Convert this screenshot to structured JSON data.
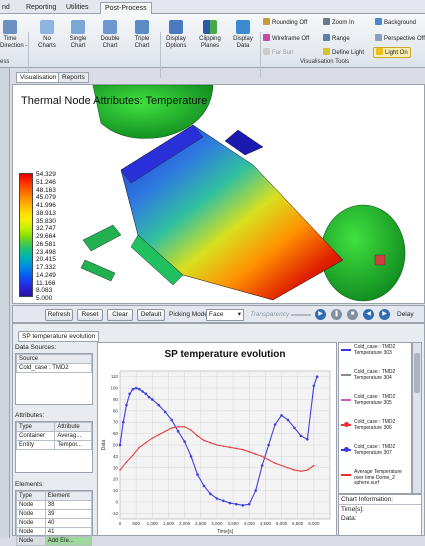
{
  "ribbon_tabs": [
    "nd",
    "Reporting",
    "Utilities",
    "Post-Process"
  ],
  "ribbon": {
    "time_direction_label": "Time\nDirection -",
    "buttons": [
      {
        "label": "No\nCharts"
      },
      {
        "label": "Single\nChart"
      },
      {
        "label": "Double\nChart"
      },
      {
        "label": "Triple\nChart"
      },
      {
        "label": "Display\nOptions"
      },
      {
        "label": "Clipping\nPlanes"
      },
      {
        "label": "Display\nData"
      }
    ],
    "options": {
      "rounding": "Rounding Off",
      "wireframe": "Wireframe Off",
      "far_sun": "Far Sun",
      "zoom": "Zoom In",
      "range": "Range",
      "define_light": "Define Light",
      "background": "Background",
      "perspective": "Perspective Off",
      "light_on": "Light On"
    },
    "group_left": "ess",
    "group_vis": "Visualisation Tools"
  },
  "view_tabs": [
    "Visualisation",
    "Reports"
  ],
  "viewport": {
    "title": "Thermal Node Attributes: Temperature",
    "legend_values": [
      "54.329",
      "51.246",
      "48.163",
      "45.079",
      "41.996",
      "38.913",
      "35.830",
      "32.747",
      "29.664",
      "26.581",
      "23.498",
      "20.415",
      "17.332",
      "14.249",
      "11.166",
      "8.083",
      "5.000"
    ],
    "legend_colors": [
      "#e00000",
      "#ff2a00",
      "#ff5a00",
      "#ff8a00",
      "#ffb000",
      "#ffd800",
      "#f4f000",
      "#c8f000",
      "#8ee000",
      "#4ccc40",
      "#18c080",
      "#00b0b8",
      "#0090e0",
      "#0068f0",
      "#1840f0",
      "#2a20d0",
      "#2a10a0"
    ]
  },
  "controls": {
    "refresh": "Refresh",
    "reset": "Reset",
    "clear": "Clear",
    "default": "Default",
    "picking_mode_label": "Picking Mode",
    "picking_mode_value": "Face",
    "transparency": "Transparency",
    "delay": "Delay"
  },
  "bottom": {
    "tab": "SP temperature evolution",
    "data_sources_label": "Data Sources:",
    "source_header": "Source",
    "source_value": "Cold_case : TMD2",
    "attributes_label": "Attributes:",
    "attr_headers": [
      "Type",
      "Attribute"
    ],
    "attr_rows": [
      [
        "Container",
        "Averag..."
      ],
      [
        "Entity",
        "Tempor..."
      ]
    ],
    "elements_label": "Elements:",
    "elem_headers": [
      "Type",
      "Element"
    ],
    "elem_rows": [
      [
        "Node",
        "38"
      ],
      [
        "Node",
        "39"
      ],
      [
        "Node",
        "40"
      ],
      [
        "Node",
        "41"
      ],
      [
        "Node",
        "Add Ele..."
      ]
    ],
    "chart_info_label": "Chart Information:",
    "chart_info_lines": [
      "Time[s]:",
      "Data:"
    ]
  },
  "legend_list": [
    {
      "text": "Cold_case : TMD2 Temperature 303",
      "color": "#3a3ad8",
      "marker": "line"
    },
    {
      "text": "Cold_case : TMD2 Temperature 304",
      "color": "#888888",
      "marker": "line"
    },
    {
      "text": "Cold_case : TMD2 Temperature 305",
      "color": "#c060c0",
      "marker": "line"
    },
    {
      "text": "Cold_case : TMD2 Temperature 306",
      "color": "#e83030",
      "marker": "dot"
    },
    {
      "text": "Cold_case : TMD2 Temperature 307",
      "color": "#3a3ad8",
      "marker": "dot"
    },
    {
      "text": "Average Temperature over time Dome_2 sphere.surf",
      "color": "#e83030",
      "marker": "line"
    }
  ],
  "chart_data": {
    "type": "line",
    "title": "SP temperature evolution",
    "ylabel": "Data",
    "xlabel": "Time[s]",
    "xlim": [
      0,
      6500
    ],
    "ylim": [
      -15,
      115
    ],
    "x_ticks": [
      0,
      500,
      1000,
      1500,
      2000,
      2500,
      3000,
      3500,
      4000,
      4500,
      5000,
      5500,
      6000
    ],
    "y_ticks": [
      -10,
      0,
      10,
      20,
      30,
      40,
      50,
      60,
      70,
      80,
      90,
      100,
      110
    ],
    "grid": true,
    "series": [
      {
        "name": "Cold_case : TMD2 Temperature 307",
        "color": "#4040e0",
        "x": [
          0,
          100,
          200,
          300,
          400,
          500,
          600,
          700,
          800,
          900,
          1000,
          1200,
          1400,
          1600,
          1800,
          2000,
          2200,
          2400,
          2600,
          2800,
          3000,
          3200,
          3400,
          3600,
          3800,
          4000,
          4200,
          4400,
          4600,
          4800,
          5000,
          5200,
          5400,
          5600,
          5800,
          6000,
          6100
        ],
        "values": [
          50,
          70,
          85,
          95,
          99,
          100,
          99,
          97,
          95,
          92,
          90,
          85,
          79,
          72,
          62,
          53,
          40,
          24,
          14,
          7,
          3,
          1,
          -1,
          -2,
          -3,
          -2,
          10,
          32,
          50,
          68,
          76,
          72,
          65,
          58,
          55,
          102,
          110
        ]
      },
      {
        "name": "Average Temperature over time Dome_2 sphere.surf",
        "color": "#e84040",
        "x": [
          0,
          200,
          400,
          600,
          800,
          1000,
          1200,
          1400,
          1600,
          1800,
          2000,
          2200,
          2400,
          2600,
          2800,
          3000,
          3200,
          3400,
          3600,
          3800,
          4000,
          4200,
          4400,
          4600,
          4800,
          5000,
          5200,
          5400,
          5600,
          5800,
          6000
        ],
        "values": [
          28,
          35,
          41,
          48,
          52,
          56,
          59,
          62,
          65,
          66,
          66,
          63,
          58,
          54,
          52,
          50,
          49,
          48,
          47,
          46,
          44,
          42,
          40,
          37,
          34,
          32,
          30,
          28,
          27,
          28,
          32
        ]
      }
    ]
  }
}
